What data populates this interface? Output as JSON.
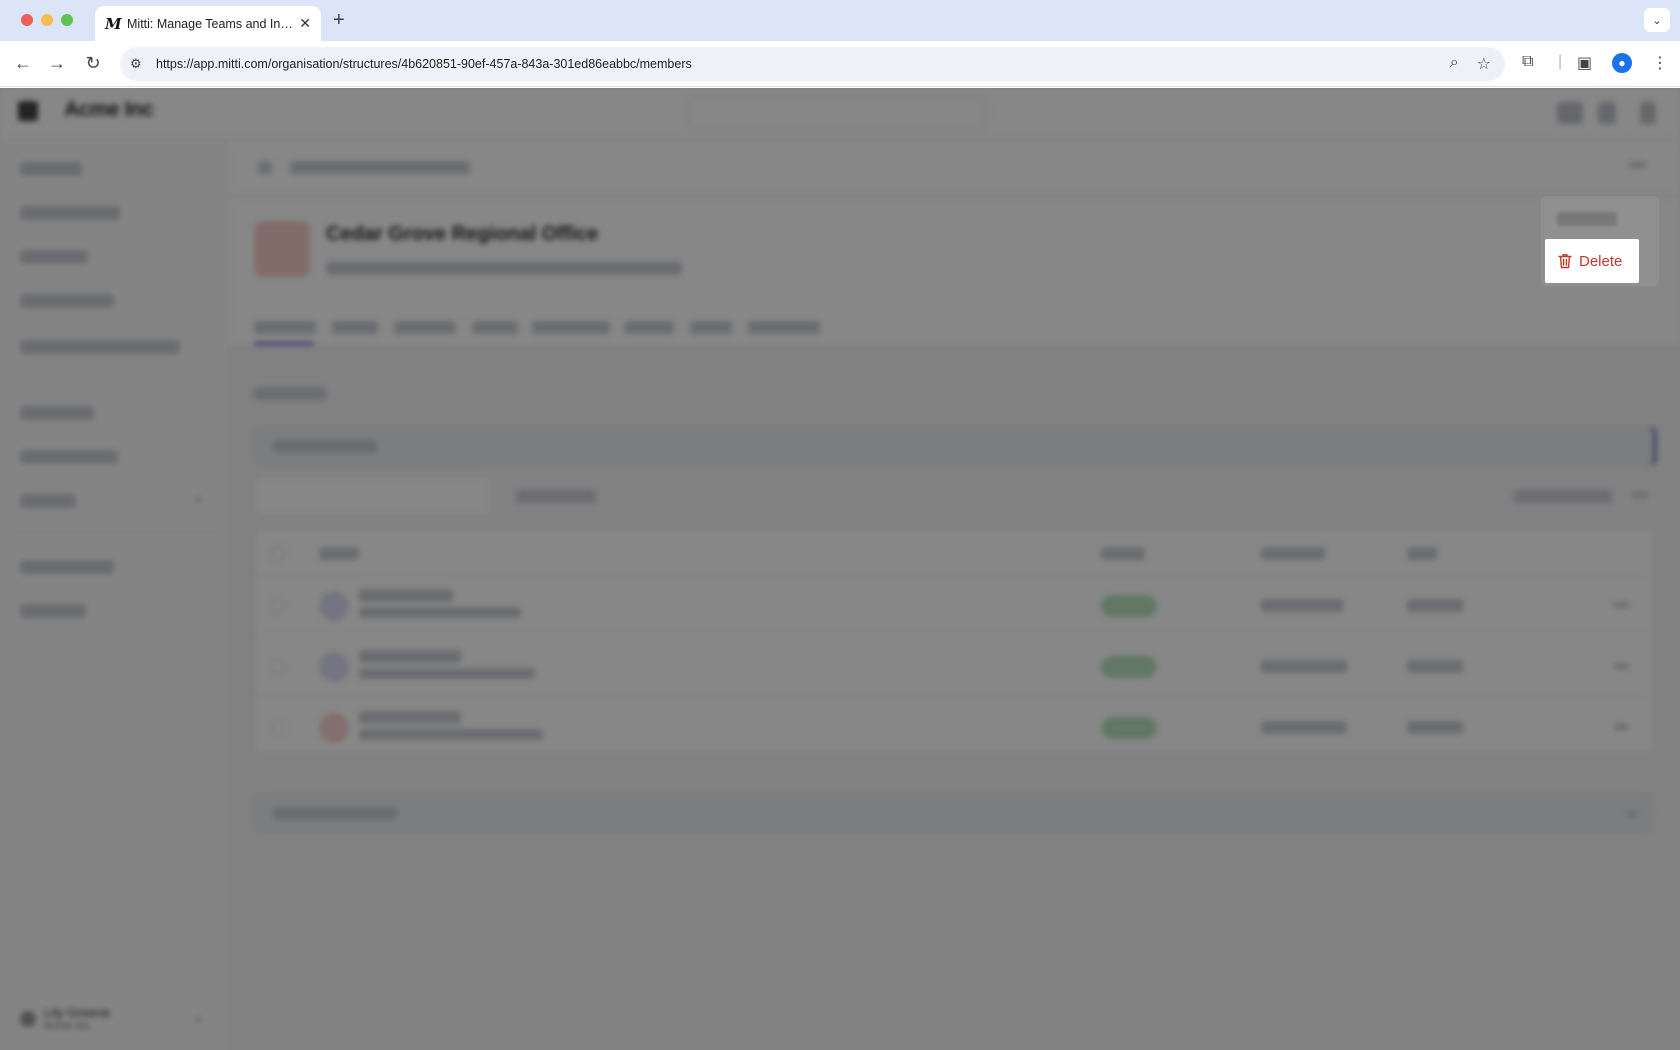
{
  "browser": {
    "tab_favicon": "M",
    "tab_title": "Mitti: Manage Teams and Inspect...",
    "tab_close": "✕",
    "new_tab": "+",
    "url": "https://app.mitti.com/organisation/structures/4b620851-90ef-457a-843a-301ed86eabbc/members",
    "icons": [
      "back-icon",
      "forward-icon",
      "reload-icon",
      "site-settings-icon",
      "zoom-icon",
      "bookmark-star-icon",
      "extensions-icon",
      "side-panel-icon",
      "profile-icon",
      "more-menu-icon"
    ]
  },
  "app": {
    "brand": "Acme Inc",
    "org_name": "Cedar Grove Regional Office",
    "user": {
      "name": "Lily Greene",
      "org": "Acme Inc."
    }
  },
  "context_menu": {
    "delete_label": "Delete",
    "delete_color": "#c0392b"
  },
  "colors": {
    "primary_button": "#2c2aa6",
    "tab_accent": "#6b5bd6",
    "status_pill": "#b9e3bf"
  }
}
